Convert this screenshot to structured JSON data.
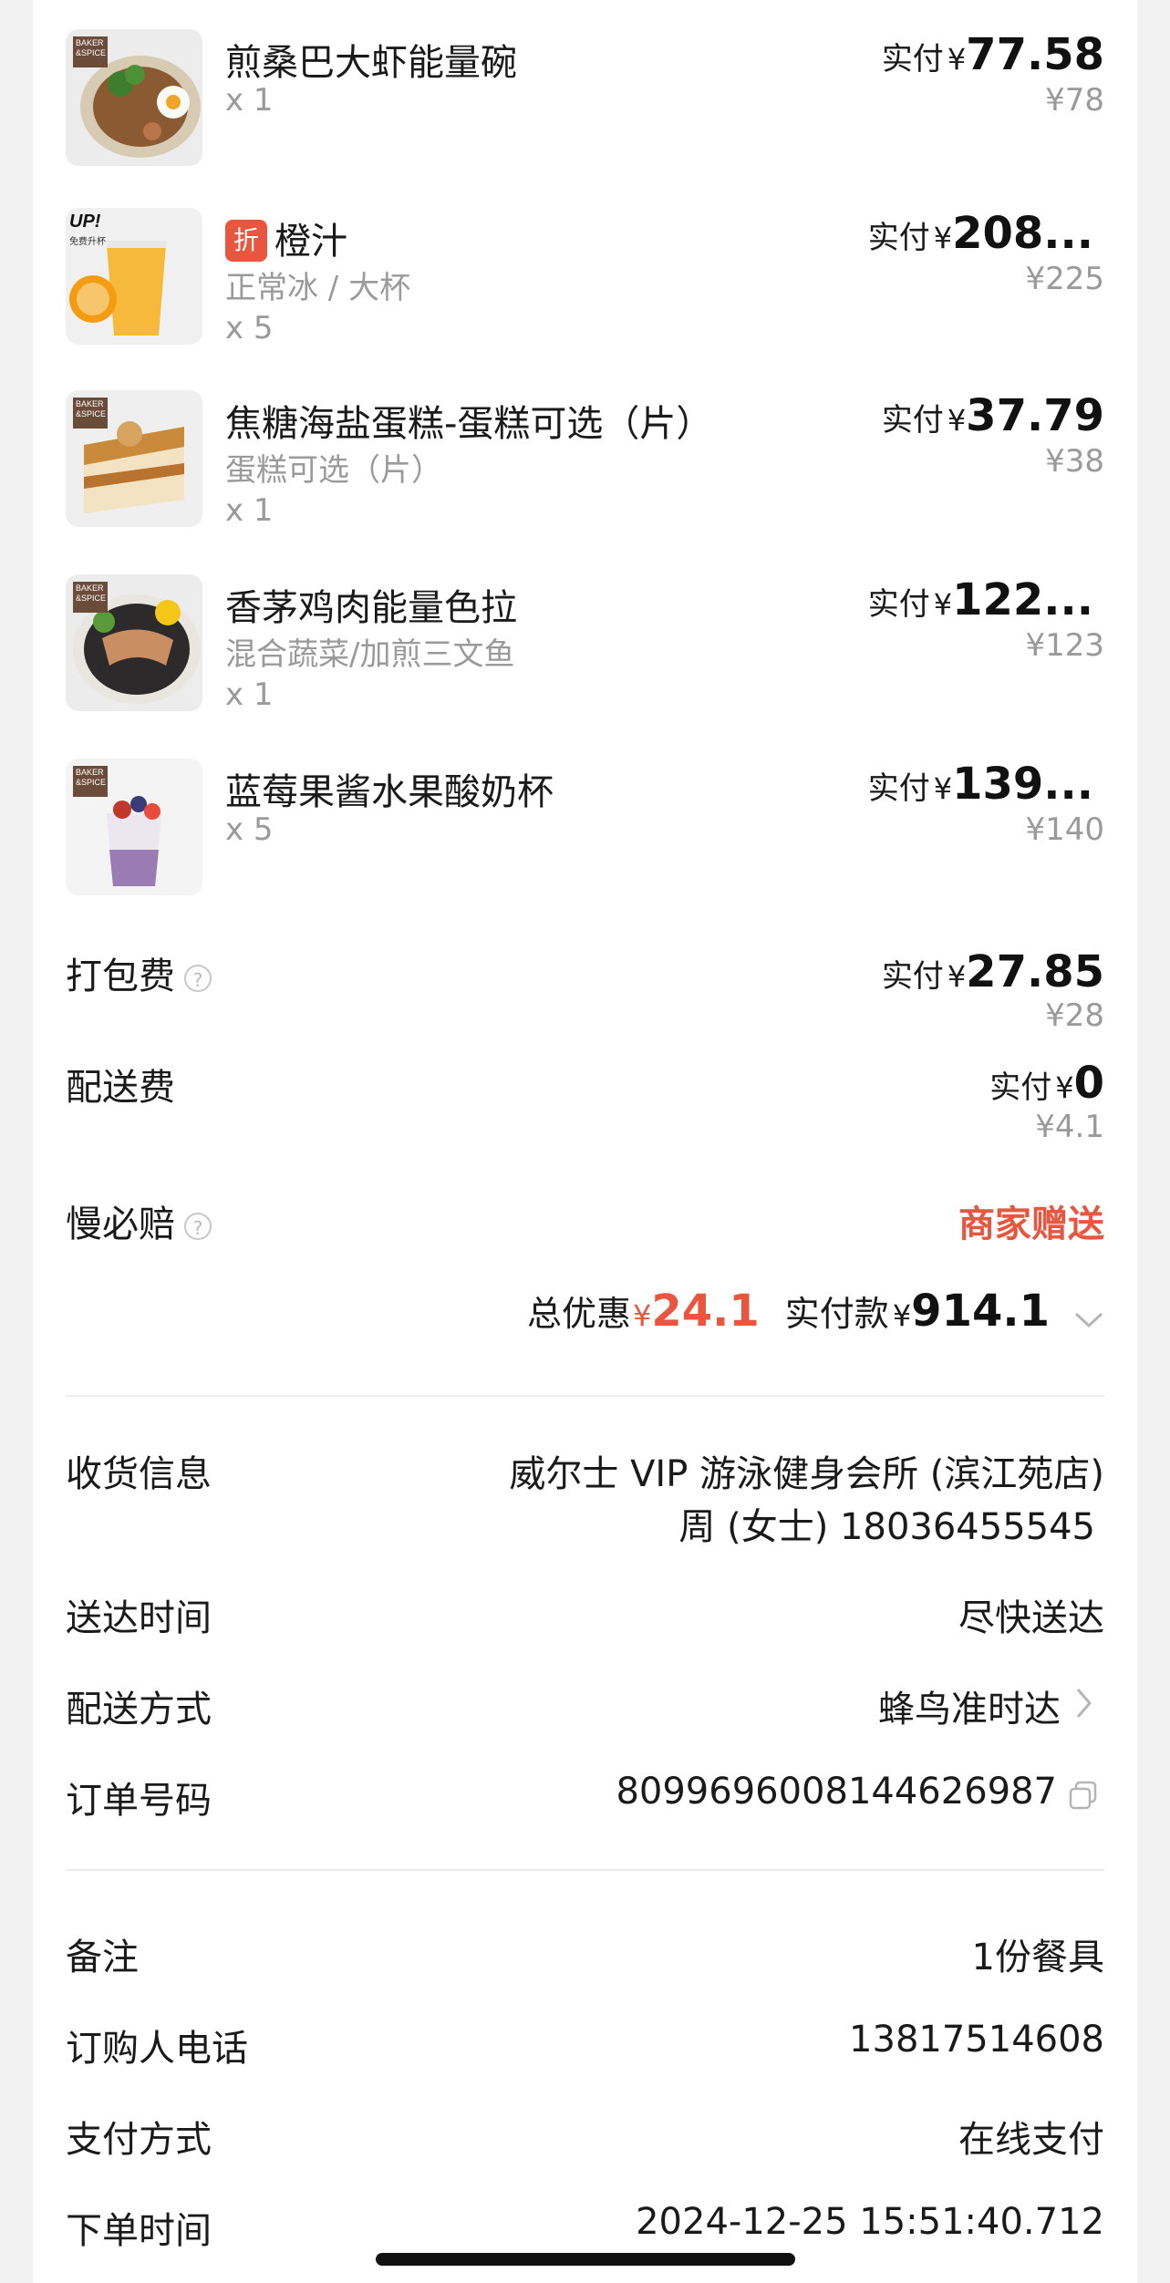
{
  "items": [
    {
      "brand": "BAKER &SPICE",
      "name": "煎桑巴大虾能量碗",
      "spec": "",
      "qty": "x 1",
      "paid_label": "实付",
      "currency": "¥",
      "amount": "77.58",
      "original": "¥78"
    },
    {
      "brand": "UP!",
      "brand_sub": "免费升杯",
      "discount_badge": "折",
      "name": "橙汁",
      "spec": "正常冰 / 大杯",
      "qty": "x 5",
      "paid_label": "实付",
      "currency": "¥",
      "amount": "208...",
      "original": "¥225"
    },
    {
      "brand": "BAKER &SPICE",
      "name": "焦糖海盐蛋糕-蛋糕可选（片）",
      "spec": "蛋糕可选（片）",
      "qty": "x 1",
      "paid_label": "实付",
      "currency": "¥",
      "amount": "37.79",
      "original": "¥38"
    },
    {
      "brand": "BAKER &SPICE",
      "name": "香茅鸡肉能量色拉",
      "spec": "混合蔬菜/加煎三文鱼",
      "qty": "x 1",
      "paid_label": "实付",
      "currency": "¥",
      "amount": "122...",
      "original": "¥123"
    },
    {
      "brand": "BAKER &SPICE",
      "name": "蓝莓果酱水果酸奶杯",
      "spec": "",
      "qty": "x 5",
      "paid_label": "实付",
      "currency": "¥",
      "amount": "139...",
      "original": "¥140"
    }
  ],
  "fees": {
    "packing": {
      "label": "打包费",
      "paid_label": "实付",
      "currency": "¥",
      "amount": "27.85",
      "original": "¥28"
    },
    "delivery": {
      "label": "配送费",
      "paid_label": "实付",
      "currency": "¥",
      "amount": "0",
      "original": "¥4.1"
    },
    "slow_comp": {
      "label": "慢必赔",
      "value": "商家赠送"
    }
  },
  "total": {
    "discount_label": "总优惠",
    "currency": "¥",
    "discount_amount": "24.1",
    "paid_label": "实付款",
    "paid_amount": "914.1"
  },
  "info": {
    "receiver_label": "收货信息",
    "receiver_line1": "威尔士 VIP 游泳健身会所 (滨江苑店)",
    "receiver_line2": "周 (女士) 18036455545",
    "arrival_label": "送达时间",
    "arrival_value": "尽快送达",
    "delivery_method_label": "配送方式",
    "delivery_method_value": "蜂鸟准时达",
    "order_no_label": "订单号码",
    "order_no_value": "8099696008144626987",
    "note_label": "备注",
    "note_value": "1份餐具",
    "buyer_phone_label": "订购人电话",
    "buyer_phone_value": "13817514608",
    "payment_label": "支付方式",
    "payment_value": "在线支付",
    "order_time_label": "下单时间",
    "order_time_value": "2024-12-25 15:51:40.712"
  },
  "colors": {
    "accent_red": "#e8563f",
    "muted_gray": "#9a9a9a",
    "background": "#f2f2f2"
  }
}
